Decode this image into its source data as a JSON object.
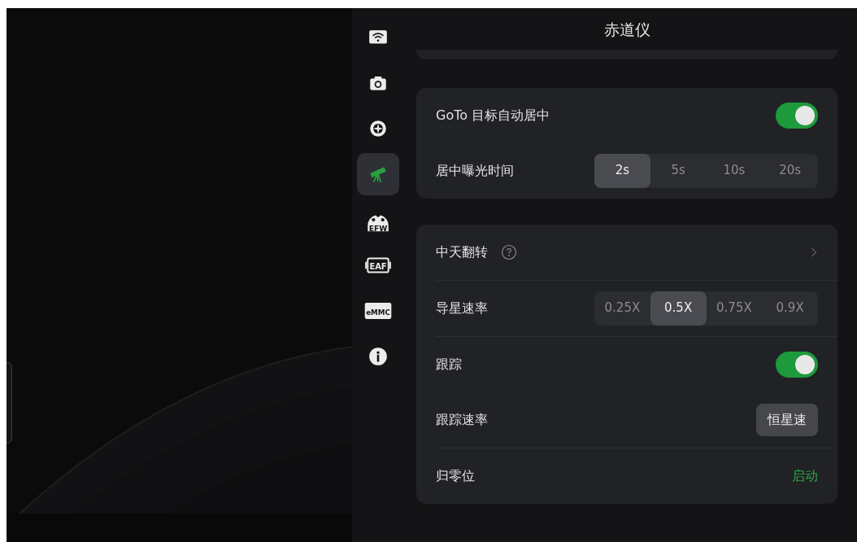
{
  "sidebar": {
    "items": [
      {
        "kind": "wifi",
        "selected": false
      },
      {
        "kind": "camera",
        "selected": false
      },
      {
        "kind": "target",
        "selected": false
      },
      {
        "kind": "telescope",
        "selected": true
      },
      {
        "kind": "efw",
        "label": "EFW",
        "selected": false
      },
      {
        "kind": "eaf",
        "label": "EAF",
        "selected": false
      },
      {
        "kind": "emmc",
        "label": "eMMC",
        "selected": false
      },
      {
        "kind": "info",
        "selected": false
      }
    ]
  },
  "panel": {
    "title": "赤道仪",
    "cards": [
      {
        "sections": [
          [
            {
              "kind": "toggle",
              "label": "GoTo 目标自动居中",
              "on": true
            },
            {
              "kind": "segmented",
              "label": "居中曝光时间",
              "options": [
                {
                  "label": "2s",
                  "selected": true
                },
                {
                  "label": "5s",
                  "selected": false
                },
                {
                  "label": "10s",
                  "selected": false
                },
                {
                  "label": "20s",
                  "selected": false
                }
              ]
            }
          ]
        ]
      },
      {
        "sections": [
          [
            {
              "kind": "link",
              "label": "中天翻转",
              "help": true
            }
          ],
          [
            {
              "kind": "segmented",
              "label": "导星速率",
              "options": [
                {
                  "label": "0.25X",
                  "selected": false
                },
                {
                  "label": "0.5X",
                  "selected": true
                },
                {
                  "label": "0.75X",
                  "selected": false
                },
                {
                  "label": "0.9X",
                  "selected": false
                }
              ]
            }
          ],
          [
            {
              "kind": "toggle",
              "label": "跟踪",
              "on": true
            },
            {
              "kind": "button",
              "label": "跟踪速率",
              "value": "恒星速"
            }
          ],
          [
            {
              "kind": "action",
              "label": "归零位",
              "value": "启动"
            }
          ]
        ]
      }
    ]
  }
}
